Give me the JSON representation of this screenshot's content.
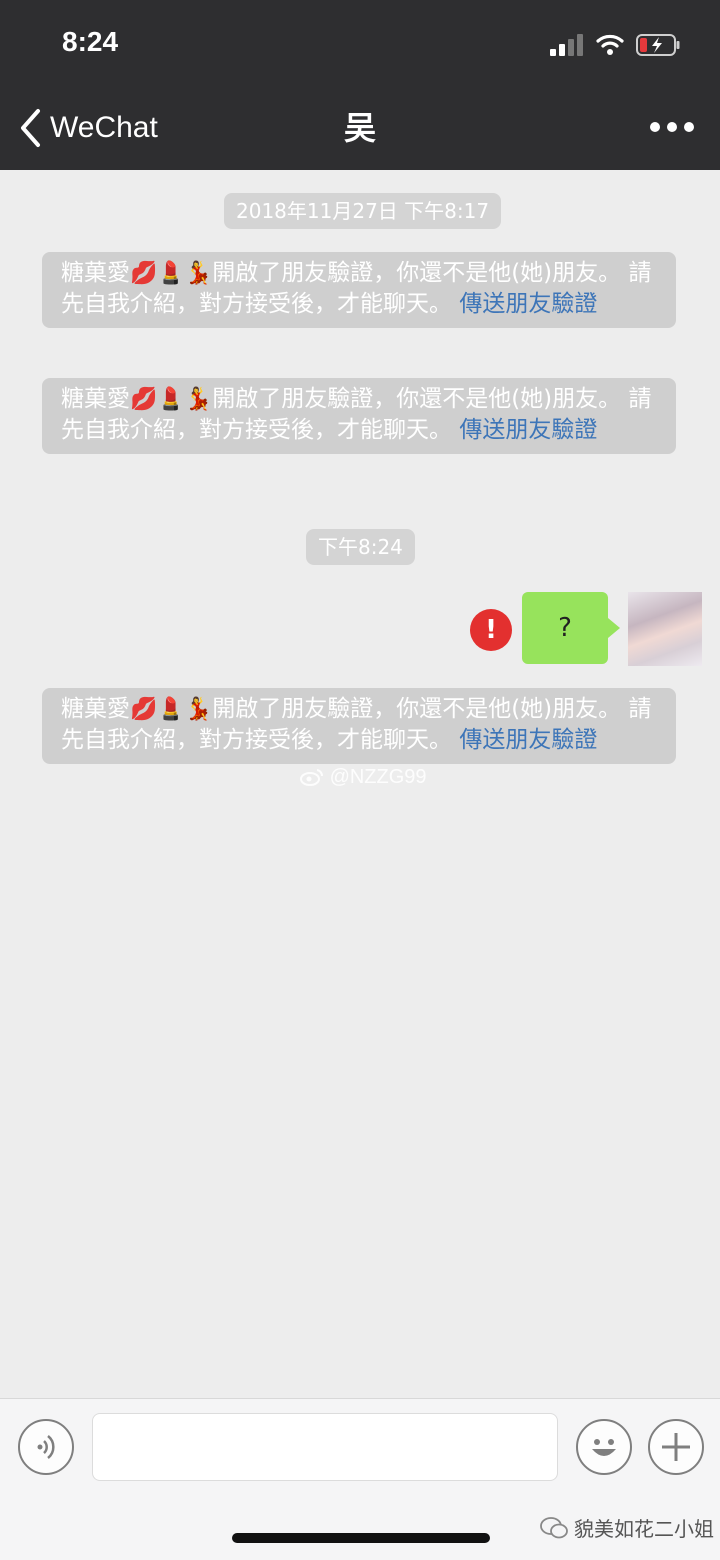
{
  "status_bar": {
    "time": "8:24"
  },
  "nav": {
    "back_label": "WeChat",
    "title": "吴"
  },
  "timestamps": [
    "2018年11月27日 下午8:17",
    "下午8:24"
  ],
  "system_messages": [
    {
      "name": "糖菓愛",
      "emojis": "💋💄💃",
      "text": "開啟了朋友驗證，你還不是他(她)朋友。 請先自我介紹，對方接受後，才能聊天。",
      "link": "傳送朋友驗證"
    },
    {
      "name": "糖菓愛",
      "emojis": "💋💄💃",
      "text": "開啟了朋友驗證，你還不是他(她)朋友。 請先自我介紹，對方接受後，才能聊天。",
      "link": "傳送朋友驗證"
    },
    {
      "name": "糖菓愛",
      "emojis": "💋💄💃",
      "text": "開啟了朋友驗證，你還不是他(她)朋友。 請先自我介紹，對方接受後，才能聊天。",
      "link": "傳送朋友驗證"
    }
  ],
  "outgoing_message": {
    "text": "?",
    "error_mark": "!"
  },
  "watermark": "@NZZG99",
  "brand_watermark": "貌美如花二小姐",
  "icons": [
    "back-chevron-icon",
    "more-icon",
    "voice-icon",
    "emoji-icon",
    "plus-icon",
    "error-icon",
    "weibo-icon",
    "wechat-logo-icon"
  ],
  "colors": {
    "header": "#2e2e30",
    "bubble": "#97e35c",
    "link": "#3d75b8",
    "error": "#e3302f"
  }
}
